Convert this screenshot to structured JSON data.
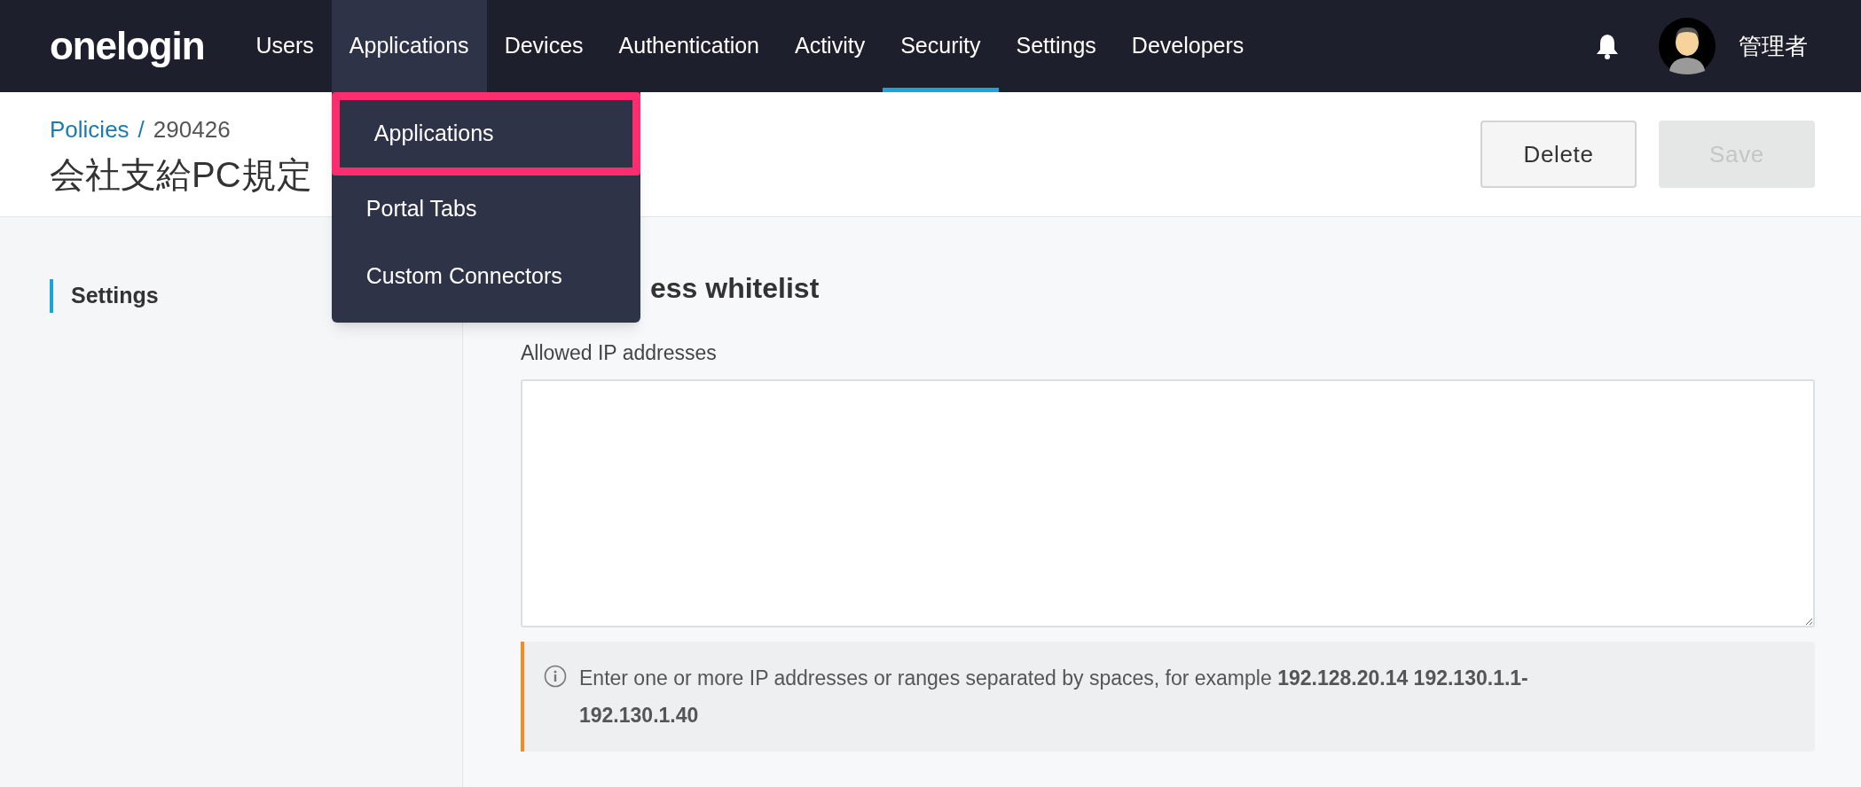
{
  "nav": {
    "logo": "onelogin",
    "items": [
      {
        "label": "Users",
        "selected": false,
        "expanded": false
      },
      {
        "label": "Applications",
        "selected": false,
        "expanded": true
      },
      {
        "label": "Devices",
        "selected": false,
        "expanded": false
      },
      {
        "label": "Authentication",
        "selected": false,
        "expanded": false
      },
      {
        "label": "Activity",
        "selected": false,
        "expanded": false
      },
      {
        "label": "Security",
        "selected": true,
        "expanded": false
      },
      {
        "label": "Settings",
        "selected": false,
        "expanded": false
      },
      {
        "label": "Developers",
        "selected": false,
        "expanded": false
      }
    ],
    "user_name": "管理者"
  },
  "dropdown": {
    "items": [
      {
        "label": "Applications",
        "selected": true
      },
      {
        "label": "Portal Tabs",
        "selected": false
      },
      {
        "label": "Custom Connectors",
        "selected": false
      }
    ]
  },
  "header": {
    "breadcrumb": [
      {
        "label": "Policies",
        "kind": "link"
      },
      {
        "label": "290426",
        "kind": "current"
      }
    ],
    "separator": "/",
    "title": "会社支給PC規定",
    "buttons": [
      {
        "label": "Delete",
        "disabled": false
      },
      {
        "label": "Save",
        "disabled": true
      }
    ]
  },
  "sidebar": {
    "items": [
      {
        "label": "Settings",
        "selected": true
      }
    ]
  },
  "section": {
    "heading": "ess whitelist",
    "field_label": "Allowed IP addresses",
    "info": "Enter one or more IP addresses or ranges separated by spaces, for example **192.128.20.14 192.130.1.1-192.130.1.40**"
  }
}
